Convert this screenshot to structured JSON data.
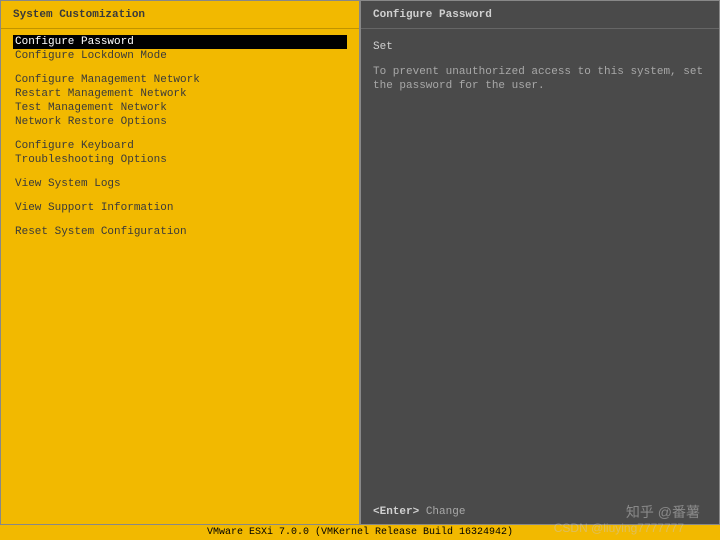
{
  "left": {
    "title": "System Customization",
    "groups": [
      [
        {
          "label": "Configure Password",
          "selected": true
        },
        {
          "label": "Configure Lockdown Mode",
          "selected": false
        }
      ],
      [
        {
          "label": "Configure Management Network",
          "selected": false
        },
        {
          "label": "Restart Management Network",
          "selected": false
        },
        {
          "label": "Test Management Network",
          "selected": false
        },
        {
          "label": "Network Restore Options",
          "selected": false
        }
      ],
      [
        {
          "label": "Configure Keyboard",
          "selected": false
        },
        {
          "label": "Troubleshooting Options",
          "selected": false
        }
      ],
      [
        {
          "label": "View System Logs",
          "selected": false
        }
      ],
      [
        {
          "label": "View Support Information",
          "selected": false
        }
      ],
      [
        {
          "label": "Reset System Configuration",
          "selected": false
        }
      ]
    ]
  },
  "right": {
    "title": "Configure Password",
    "heading": "Set",
    "description": "To prevent unauthorized access to this system, set the password for the user."
  },
  "hints": {
    "key": "<Enter>",
    "action": "Change"
  },
  "status_bar": "VMware ESXi 7.0.0 (VMKernel Release Build 16324942)",
  "watermarks": {
    "w1": "知乎 @番薯",
    "w2": "CSDN @liuying7777777"
  }
}
